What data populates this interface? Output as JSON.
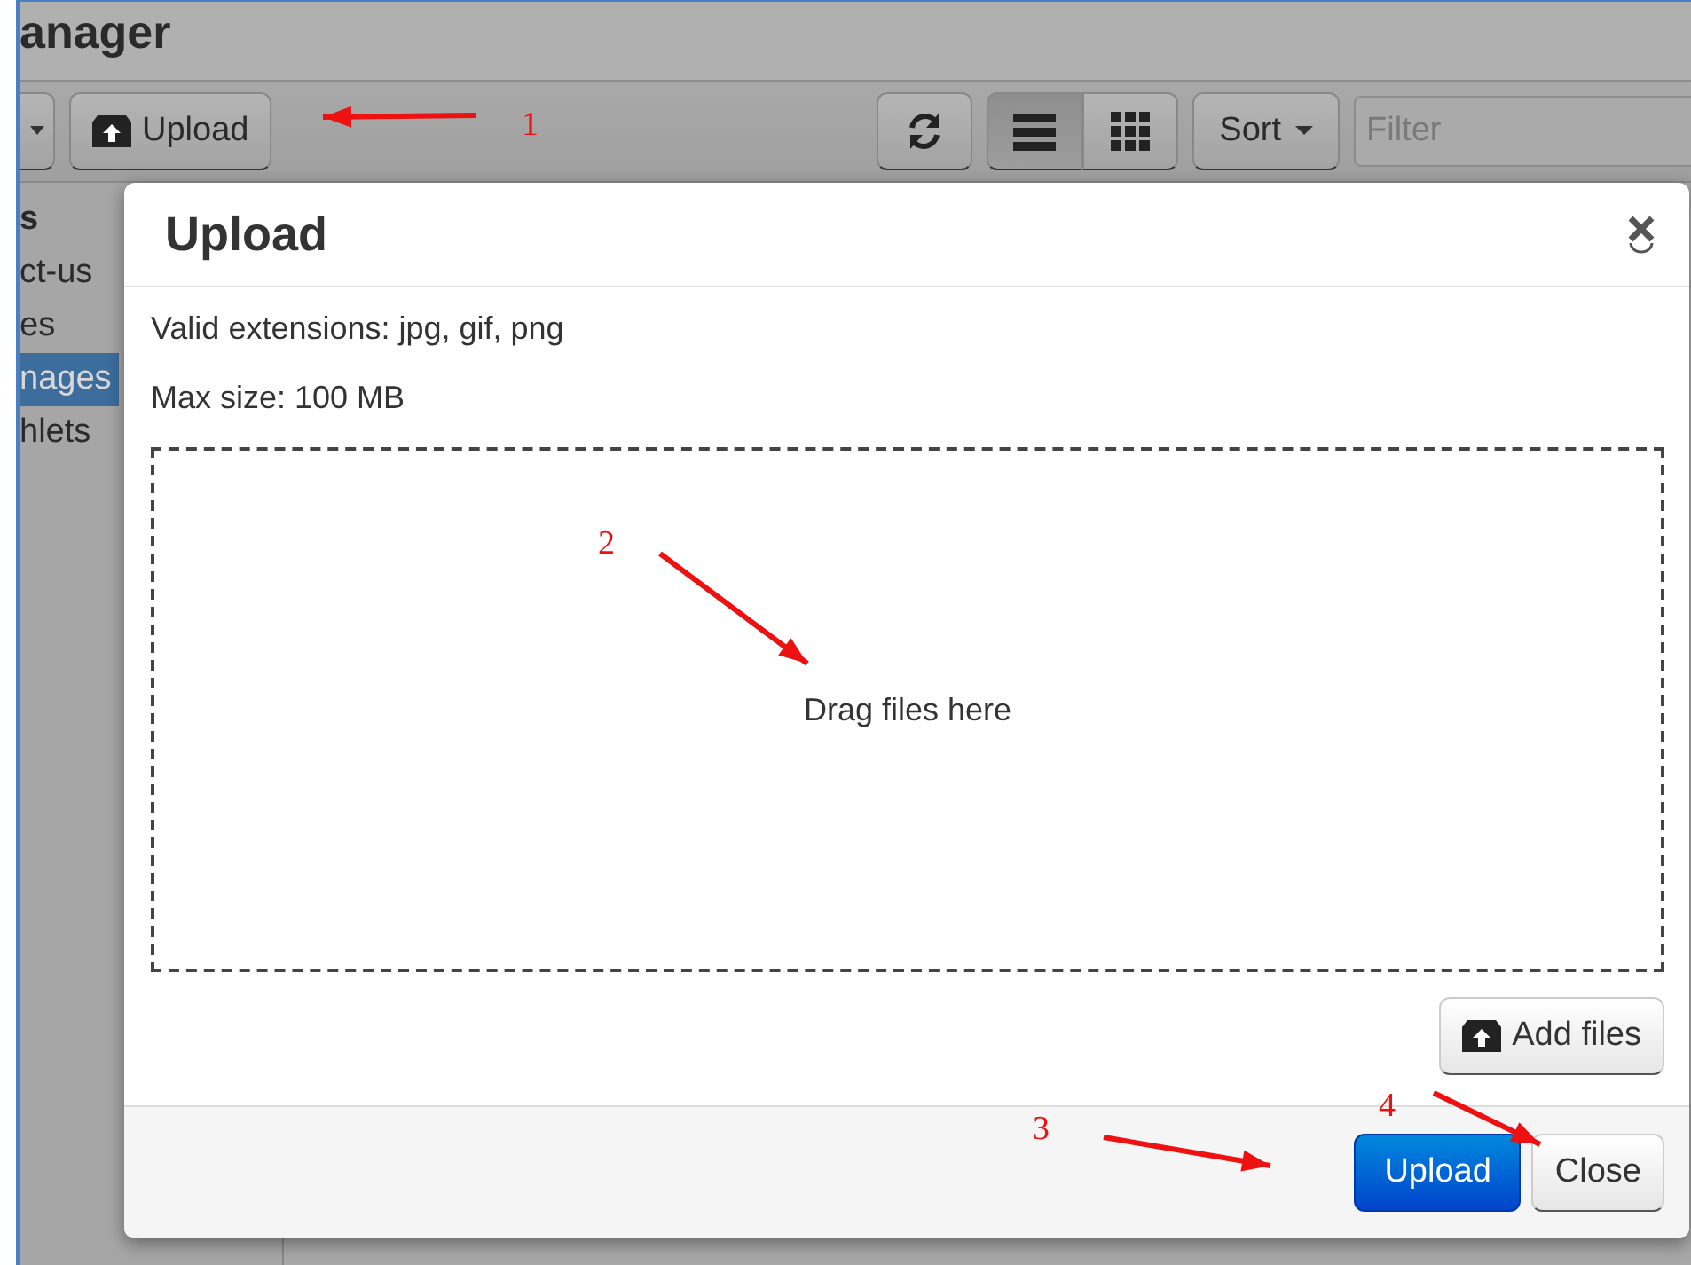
{
  "page": {
    "title": "anager"
  },
  "toolbar": {
    "upload_button": "Upload",
    "view_toggle": [
      {
        "kind": "list",
        "selected": true
      },
      {
        "kind": "grid",
        "selected": false
      }
    ],
    "sort_button": "Sort",
    "filter": {
      "placeholder": "Filter"
    }
  },
  "sidebar": {
    "items": [
      {
        "label": "s",
        "kind": "heading",
        "selected": false
      },
      {
        "label": "ct-us",
        "kind": "item",
        "selected": false
      },
      {
        "label": "es",
        "kind": "item",
        "selected": false
      },
      {
        "label": "nages",
        "kind": "item",
        "selected": true
      },
      {
        "label": "hlets",
        "kind": "item",
        "selected": false
      }
    ]
  },
  "dialog": {
    "title": "Upload",
    "lines": [
      "Valid extensions: jpg, gif, png",
      "Max size: 100 MB"
    ],
    "drop_zone": "Drag files here",
    "add_files_button": "Add files",
    "footer_buttons": [
      {
        "label": "Upload",
        "kind": "primary"
      },
      {
        "label": "Close",
        "kind": "default"
      }
    ]
  },
  "annotations": [
    {
      "label": "1"
    },
    {
      "label": "2"
    },
    {
      "label": "3"
    },
    {
      "label": "4"
    }
  ]
}
